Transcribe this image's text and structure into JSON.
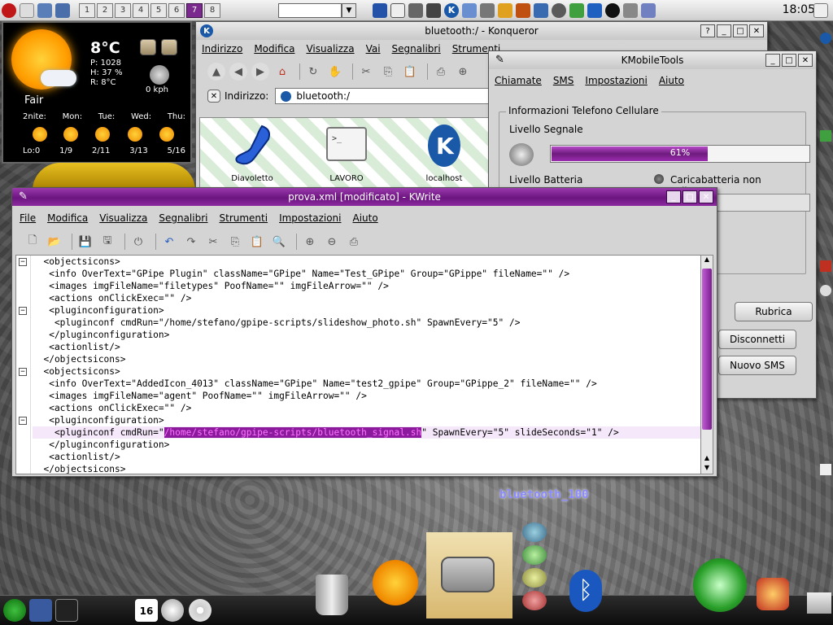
{
  "top_panel": {
    "virtual_desktops": [
      "1",
      "2",
      "3",
      "4",
      "5",
      "6",
      "7",
      "8"
    ],
    "active_desktop_index": 6,
    "clock": "18:05"
  },
  "weather": {
    "temperature": "8°C",
    "pressure": "P: 1028",
    "humidity": "H: 37 %",
    "realfeel": "R: 8°C",
    "wind": "0 kph",
    "condition": "Fair",
    "days": [
      "2nite:",
      "Mon:",
      "Tue:",
      "Wed:",
      "Thu:"
    ],
    "lows_highs": [
      "Lo:0",
      "1/9",
      "2/11",
      "3/13",
      "5/16"
    ]
  },
  "konqueror": {
    "title": "bluetooth:/ - Konqueror",
    "menu": [
      "Indirizzo",
      "Modifica",
      "Visualizza",
      "Vai",
      "Segnalibri",
      "Strumenti"
    ],
    "address_label": "Indirizzo:",
    "address_value": "bluetooth:/",
    "files": [
      "Diavoletto",
      "LAVORO",
      "localhost"
    ]
  },
  "kmobiletools": {
    "title": "KMobileTools",
    "menu": [
      "Chiamate",
      "SMS",
      "Impostazioni",
      "Aiuto"
    ],
    "group_title": "Informazioni Telefono Cellulare",
    "signal_label": "Livello Segnale",
    "signal_value": 61,
    "signal_text": "61%",
    "battery_label": "Livello Batteria",
    "charger_status": "Caricabatteria non collegato",
    "buttons": [
      "Rubrica",
      "Disconnetti",
      "Nuovo SMS"
    ]
  },
  "kwrite": {
    "title": "prova.xml [modificato] - KWrite",
    "menu": [
      "File",
      "Modifica",
      "Visualizza",
      "Segnalibri",
      "Strumenti",
      "Impostazioni",
      "Aiuto"
    ],
    "lines": [
      "  <objectsicons>",
      "   <info OverText=\"GPipe Plugin\" className=\"GPipe\" Name=\"Test_GPipe\" Group=\"GPippe\" fileName=\"\" />",
      "   <images imgFileName=\"filetypes\" PoofName=\"\" imgFileArrow=\"\" />",
      "   <actions onClickExec=\"\" />",
      "   <pluginconfiguration>",
      "    <pluginconf cmdRun=\"/home/stefano/gpipe-scripts/slideshow_photo.sh\" SpawnEvery=\"5\" />",
      "   </pluginconfiguration>",
      "   <actionlist/>",
      "  </objectsicons>",
      "  <objectsicons>",
      "   <info OverText=\"AddedIcon_4013\" className=\"GPipe\" Name=\"test2_gpipe\" Group=\"GPippe_2\" fileName=\"\" />",
      "   <images imgFileName=\"agent\" PoofName=\"\" imgFileArrow=\"\" />",
      "   <actions onClickExec=\"\" />",
      "   <pluginconfiguration>",
      "    <pluginconf cmdRun=\"",
      "   </pluginconfiguration>",
      "   <actionlist/>",
      "  </objectsicons>"
    ],
    "selected_text": "/home/stefano/gpipe-scripts/bluetooth_signal.sh",
    "after_selection": "\" SpawnEvery=\"5\" slideSeconds=\"1\" />"
  },
  "desktop": {
    "bluetooth_label": "bluetooth_100"
  },
  "bottom_panel": {
    "calendar_day": "16"
  }
}
